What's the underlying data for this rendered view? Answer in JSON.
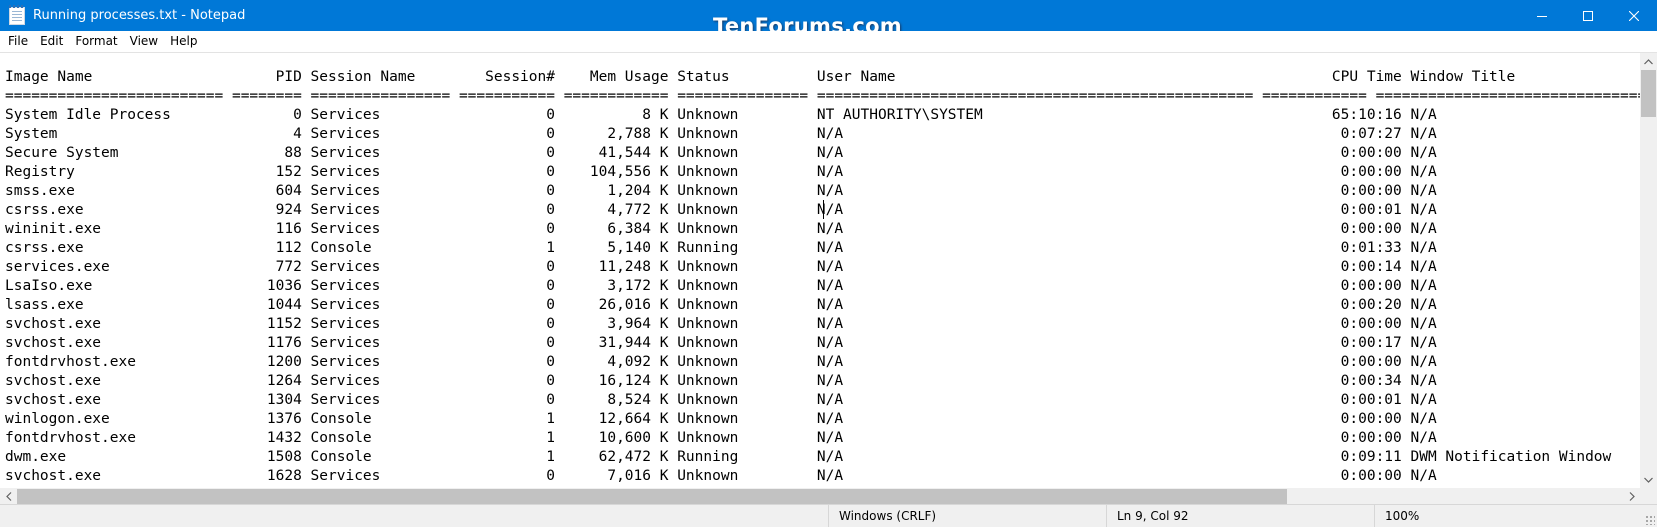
{
  "window": {
    "title": "Running processes.txt - Notepad",
    "watermark": "TenForums.com",
    "controls": [
      "minimize-icon",
      "maximize-icon",
      "close-icon"
    ]
  },
  "menu": {
    "items": [
      "File",
      "Edit",
      "Format",
      "View",
      "Help"
    ]
  },
  "editor": {
    "lines": [
      "Image Name                     PID Session Name        Session#    Mem Usage Status          User Name                                                  CPU Time Window Title",
      "========================= ======== ================ =========== ============ =============== ================================================== ============ ========================================================================",
      "System Idle Process              0 Services                   0          8 K Unknown         NT AUTHORITY\\SYSTEM                                        65:10:16 N/A",
      "System                           4 Services                   0      2,788 K Unknown         N/A                                                         0:07:27 N/A",
      "Secure System                   88 Services                   0     41,544 K Unknown         N/A                                                         0:00:00 N/A",
      "Registry                       152 Services                   0    104,556 K Unknown         N/A                                                         0:00:00 N/A",
      "smss.exe                       604 Services                   0      1,204 K Unknown         N/A                                                         0:00:00 N/A",
      "csrss.exe                      924 Services                   0      4,772 K Unknown         N/A                                                         0:00:01 N/A",
      "wininit.exe                    116 Services                   0      6,384 K Unknown         N/A                                                         0:00:00 N/A",
      "csrss.exe                      112 Console                    1      5,140 K Running         N/A                                                         0:01:33 N/A",
      "services.exe                   772 Services                   0     11,248 K Unknown         N/A                                                         0:00:14 N/A",
      "LsaIso.exe                    1036 Services                   0      3,172 K Unknown         N/A                                                         0:00:00 N/A",
      "lsass.exe                     1044 Services                   0     26,016 K Unknown         N/A                                                         0:00:20 N/A",
      "svchost.exe                   1152 Services                   0      3,964 K Unknown         N/A                                                         0:00:00 N/A",
      "svchost.exe                   1176 Services                   0     31,944 K Unknown         N/A                                                         0:00:17 N/A",
      "fontdrvhost.exe               1200 Services                   0      4,092 K Unknown         N/A                                                         0:00:00 N/A",
      "svchost.exe                   1264 Services                   0     16,124 K Unknown         N/A                                                         0:00:34 N/A",
      "svchost.exe                   1304 Services                   0      8,524 K Unknown         N/A                                                         0:00:01 N/A",
      "winlogon.exe                  1376 Console                    1     12,664 K Unknown         N/A                                                         0:00:00 N/A",
      "fontdrvhost.exe               1432 Console                    1     10,600 K Unknown         N/A                                                         0:00:00 N/A",
      "dwm.exe                       1508 Console                    1     62,472 K Running         N/A                                                         0:09:11 DWM Notification Window",
      "svchost.exe                   1628 Services                   0      7,016 K Unknown         N/A                                                         0:00:00 N/A"
    ]
  },
  "status": {
    "line_ending": "Windows (CRLF)",
    "position": "Ln 9, Col 92",
    "zoom": "100%"
  },
  "colors": {
    "titlebar": "#0078d7",
    "statusbar": "#f0f0f0",
    "scroll_thumb": "#c2c2c2"
  }
}
